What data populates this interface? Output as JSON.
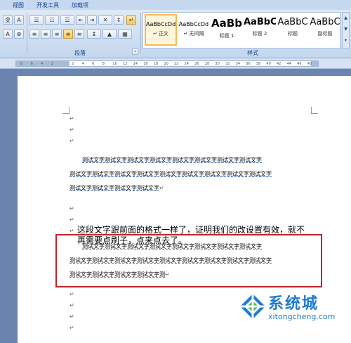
{
  "tabs": [
    "视图",
    "开发工具",
    "加载项"
  ],
  "ribbon": {
    "paragraph_group_label": "段落",
    "styles_group_label": "样式",
    "styles": [
      {
        "sample": "AaBbCcDd",
        "name": "↵ 正文",
        "selected": true
      },
      {
        "sample": "AaBbCcDd",
        "name": "↵ 无间隔",
        "selected": false
      },
      {
        "sample": "AaBb",
        "name": "标题 1",
        "selected": false
      },
      {
        "sample": "AaBbC",
        "name": "标题 2",
        "selected": false
      },
      {
        "sample": "AaBbC",
        "name": "标题",
        "selected": false
      },
      {
        "sample": "AaBbC",
        "name": "副标题",
        "selected": false
      }
    ]
  },
  "ruler": {
    "ticks": [
      "8",
      "6",
      "4",
      "2",
      "",
      "2",
      "4",
      "6",
      "8",
      "10",
      "12",
      "14",
      "16",
      "18",
      "20",
      "22",
      "24",
      "26",
      "28",
      "30",
      "32",
      "34",
      "36",
      "38",
      "40",
      "42",
      "44",
      "46",
      "48"
    ]
  },
  "document": {
    "paragraph_mark": "↵",
    "para1": {
      "lines": [
        "测试文字测试文字测试文字测试文字测试文字测试文字测试文字测试文字",
        "测试文字测试文字测试文字测试文字测试文字测试文字测试文字测试文字测试文字",
        "测试文字测试文字测试文字测试文字"
      ]
    },
    "para2": {
      "lines": [
        "测试文字测试文字测试文字测试文字测试文字测试文字测试文字测试文字",
        "测试文字测试文字测试文字测试文字测试文字测试文字测试文字测试文字测试文字",
        "测试文字测试文字测试文字测试文字测"
      ]
    },
    "para3": {
      "lines": [
        "这段文字跟前面的格式一样了，证明我们的改设置有效，就不",
        "再需要点刷子，点来点去了。"
      ]
    }
  },
  "watermark": {
    "brand": "系统城",
    "url": "xitongcheng.com"
  }
}
